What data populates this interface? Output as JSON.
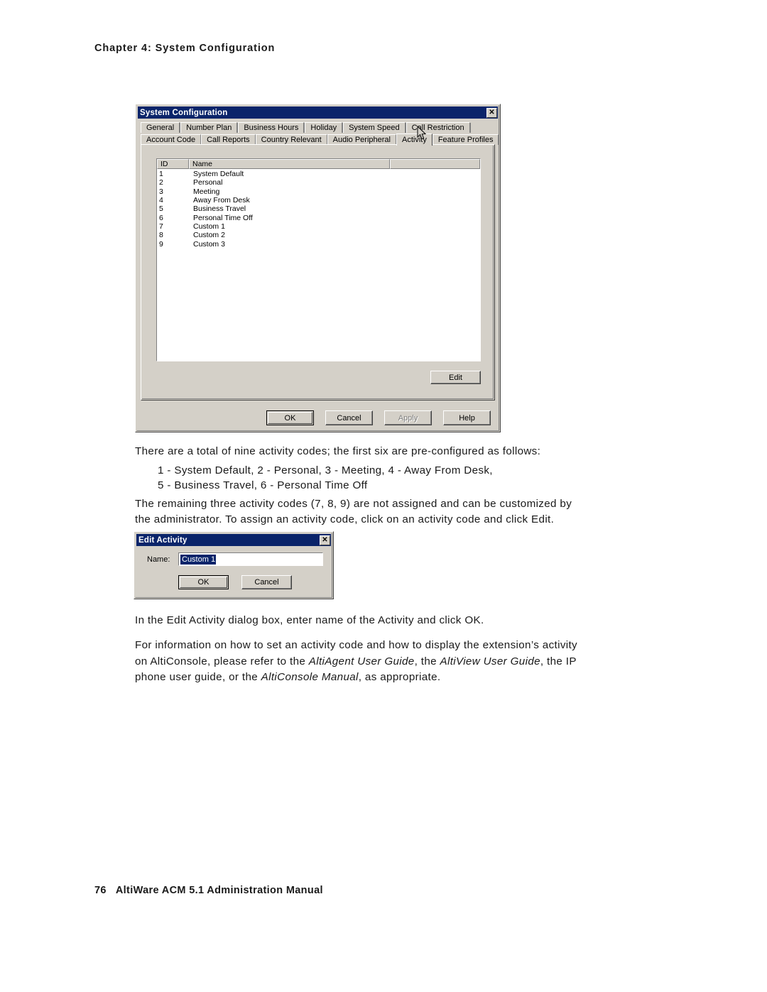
{
  "page": {
    "header": "Chapter 4:  System Configuration",
    "footer_page_number": "76",
    "footer_title": "AltiWare ACM 5.1 Administration Manual"
  },
  "system_config_dialog": {
    "title": "System Configuration",
    "close_icon": "✕",
    "tabs_row1": [
      "General",
      "Number Plan",
      "Business Hours",
      "Holiday",
      "System Speed",
      "Call Restriction"
    ],
    "tabs_row2": [
      "Account Code",
      "Call Reports",
      "Country Relevant",
      "Audio Peripheral",
      "Activity",
      "Feature Profiles"
    ],
    "selected_tab": "Activity",
    "list": {
      "columns": [
        "ID",
        "Name",
        ""
      ],
      "rows": [
        {
          "id": "1",
          "name": "System Default"
        },
        {
          "id": "2",
          "name": "Personal"
        },
        {
          "id": "3",
          "name": "Meeting"
        },
        {
          "id": "4",
          "name": "Away From Desk"
        },
        {
          "id": "5",
          "name": "Business Travel"
        },
        {
          "id": "6",
          "name": "Personal Time Off"
        },
        {
          "id": "7",
          "name": "Custom 1"
        },
        {
          "id": "8",
          "name": "Custom 2"
        },
        {
          "id": "9",
          "name": "Custom 3"
        }
      ]
    },
    "edit_button": "Edit",
    "footer_buttons": [
      {
        "label": "OK",
        "state": "default"
      },
      {
        "label": "Cancel",
        "state": "normal"
      },
      {
        "label": "Apply",
        "state": "disabled"
      },
      {
        "label": "Help",
        "state": "normal"
      }
    ]
  },
  "edit_activity_dialog": {
    "title": "Edit Activity",
    "close_icon": "✕",
    "name_label": "Name:",
    "name_value": "Custom 1",
    "ok_label": "OK",
    "cancel_label": "Cancel"
  },
  "body_text": {
    "p1": "There are a total of nine activity codes; the first six are pre-configured as follows:",
    "list_line1": "1 - System Default, 2 - Personal, 3 - Meeting, 4 - Away From Desk,",
    "list_line2": "5 - Business Travel, 6 - Personal Time Off",
    "p2_line1": "The remaining three activity codes (7, 8, 9) are not assigned and can be customized by",
    "p2_line2": "the administrator. To assign an activity code, click on an activity code and click Edit.",
    "p3": "In the Edit Activity dialog box, enter name of the Activity and click OK.",
    "p4_line1": "For information on how to set an activity code and how to display the extension’s activity",
    "p4_line2_a": "on AltiConsole, please refer to the ",
    "p4_line2_i1": "AltiAgent User Guide",
    "p4_line2_b": ", the ",
    "p4_line2_i2": "AltiView User Guide",
    "p4_line2_c": ", the IP",
    "p4_line3_a": "phone user guide, or the ",
    "p4_line3_i1": "AltiConsole Manual",
    "p4_line3_b": ", as appropriate."
  }
}
